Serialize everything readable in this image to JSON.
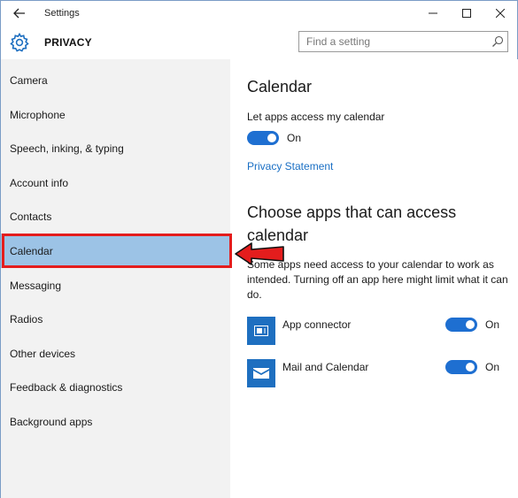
{
  "titlebar": {
    "title": "Settings",
    "back_icon": "back-arrow-icon",
    "minimize_icon": "minimize-icon",
    "maximize_icon": "maximize-icon",
    "close_icon": "close-icon"
  },
  "header": {
    "section_title": "PRIVACY",
    "icon": "gear-icon",
    "search": {
      "placeholder": "Find a setting",
      "value": "",
      "icon": "search-icon"
    }
  },
  "sidebar": {
    "items": [
      {
        "label": "Camera",
        "selected": false
      },
      {
        "label": "Microphone",
        "selected": false
      },
      {
        "label": "Speech, inking, & typing",
        "selected": false
      },
      {
        "label": "Account info",
        "selected": false
      },
      {
        "label": "Contacts",
        "selected": false
      },
      {
        "label": "Calendar",
        "selected": true
      },
      {
        "label": "Messaging",
        "selected": false
      },
      {
        "label": "Radios",
        "selected": false
      },
      {
        "label": "Other devices",
        "selected": false
      },
      {
        "label": "Feedback & diagnostics",
        "selected": false
      },
      {
        "label": "Background apps",
        "selected": false
      }
    ]
  },
  "main": {
    "title": "Calendar",
    "access_label": "Let apps access my calendar",
    "access_toggle": {
      "state": "On",
      "on": true
    },
    "privacy_link": "Privacy Statement",
    "apps_heading": "Choose apps that can access calendar",
    "apps_description": "Some apps need access to your calendar to work as intended. Turning off an app here might limit what it can do.",
    "apps": [
      {
        "name": "App connector",
        "icon": "app-connector-icon",
        "toggle": "On",
        "on": true
      },
      {
        "name": "Mail and Calendar",
        "icon": "mail-envelope-icon",
        "toggle": "On",
        "on": true
      }
    ]
  },
  "colors": {
    "accent": "#1e6fd1",
    "link": "#1a6fc4",
    "selected_bg": "#9cc3e6",
    "highlight": "#e41d1d",
    "sidebar_bg": "#f2f2f2"
  }
}
